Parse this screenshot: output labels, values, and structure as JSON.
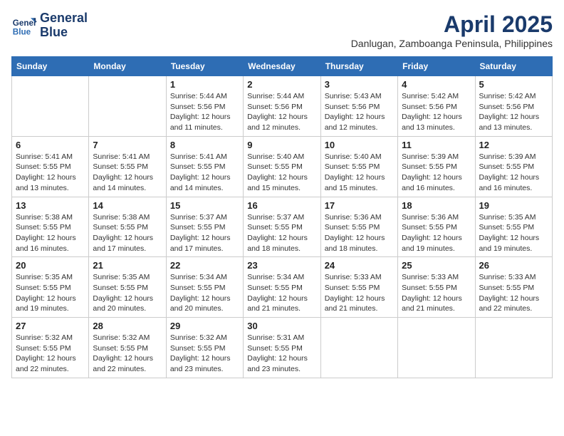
{
  "logo": {
    "line1": "General",
    "line2": "Blue"
  },
  "title": "April 2025",
  "subtitle": "Danlugan, Zamboanga Peninsula, Philippines",
  "days_of_week": [
    "Sunday",
    "Monday",
    "Tuesday",
    "Wednesday",
    "Thursday",
    "Friday",
    "Saturday"
  ],
  "weeks": [
    [
      {
        "num": "",
        "info": ""
      },
      {
        "num": "",
        "info": ""
      },
      {
        "num": "1",
        "info": "Sunrise: 5:44 AM\nSunset: 5:56 PM\nDaylight: 12 hours and 11 minutes."
      },
      {
        "num": "2",
        "info": "Sunrise: 5:44 AM\nSunset: 5:56 PM\nDaylight: 12 hours and 12 minutes."
      },
      {
        "num": "3",
        "info": "Sunrise: 5:43 AM\nSunset: 5:56 PM\nDaylight: 12 hours and 12 minutes."
      },
      {
        "num": "4",
        "info": "Sunrise: 5:42 AM\nSunset: 5:56 PM\nDaylight: 12 hours and 13 minutes."
      },
      {
        "num": "5",
        "info": "Sunrise: 5:42 AM\nSunset: 5:56 PM\nDaylight: 12 hours and 13 minutes."
      }
    ],
    [
      {
        "num": "6",
        "info": "Sunrise: 5:41 AM\nSunset: 5:55 PM\nDaylight: 12 hours and 13 minutes."
      },
      {
        "num": "7",
        "info": "Sunrise: 5:41 AM\nSunset: 5:55 PM\nDaylight: 12 hours and 14 minutes."
      },
      {
        "num": "8",
        "info": "Sunrise: 5:41 AM\nSunset: 5:55 PM\nDaylight: 12 hours and 14 minutes."
      },
      {
        "num": "9",
        "info": "Sunrise: 5:40 AM\nSunset: 5:55 PM\nDaylight: 12 hours and 15 minutes."
      },
      {
        "num": "10",
        "info": "Sunrise: 5:40 AM\nSunset: 5:55 PM\nDaylight: 12 hours and 15 minutes."
      },
      {
        "num": "11",
        "info": "Sunrise: 5:39 AM\nSunset: 5:55 PM\nDaylight: 12 hours and 16 minutes."
      },
      {
        "num": "12",
        "info": "Sunrise: 5:39 AM\nSunset: 5:55 PM\nDaylight: 12 hours and 16 minutes."
      }
    ],
    [
      {
        "num": "13",
        "info": "Sunrise: 5:38 AM\nSunset: 5:55 PM\nDaylight: 12 hours and 16 minutes."
      },
      {
        "num": "14",
        "info": "Sunrise: 5:38 AM\nSunset: 5:55 PM\nDaylight: 12 hours and 17 minutes."
      },
      {
        "num": "15",
        "info": "Sunrise: 5:37 AM\nSunset: 5:55 PM\nDaylight: 12 hours and 17 minutes."
      },
      {
        "num": "16",
        "info": "Sunrise: 5:37 AM\nSunset: 5:55 PM\nDaylight: 12 hours and 18 minutes."
      },
      {
        "num": "17",
        "info": "Sunrise: 5:36 AM\nSunset: 5:55 PM\nDaylight: 12 hours and 18 minutes."
      },
      {
        "num": "18",
        "info": "Sunrise: 5:36 AM\nSunset: 5:55 PM\nDaylight: 12 hours and 19 minutes."
      },
      {
        "num": "19",
        "info": "Sunrise: 5:35 AM\nSunset: 5:55 PM\nDaylight: 12 hours and 19 minutes."
      }
    ],
    [
      {
        "num": "20",
        "info": "Sunrise: 5:35 AM\nSunset: 5:55 PM\nDaylight: 12 hours and 19 minutes."
      },
      {
        "num": "21",
        "info": "Sunrise: 5:35 AM\nSunset: 5:55 PM\nDaylight: 12 hours and 20 minutes."
      },
      {
        "num": "22",
        "info": "Sunrise: 5:34 AM\nSunset: 5:55 PM\nDaylight: 12 hours and 20 minutes."
      },
      {
        "num": "23",
        "info": "Sunrise: 5:34 AM\nSunset: 5:55 PM\nDaylight: 12 hours and 21 minutes."
      },
      {
        "num": "24",
        "info": "Sunrise: 5:33 AM\nSunset: 5:55 PM\nDaylight: 12 hours and 21 minutes."
      },
      {
        "num": "25",
        "info": "Sunrise: 5:33 AM\nSunset: 5:55 PM\nDaylight: 12 hours and 21 minutes."
      },
      {
        "num": "26",
        "info": "Sunrise: 5:33 AM\nSunset: 5:55 PM\nDaylight: 12 hours and 22 minutes."
      }
    ],
    [
      {
        "num": "27",
        "info": "Sunrise: 5:32 AM\nSunset: 5:55 PM\nDaylight: 12 hours and 22 minutes."
      },
      {
        "num": "28",
        "info": "Sunrise: 5:32 AM\nSunset: 5:55 PM\nDaylight: 12 hours and 22 minutes."
      },
      {
        "num": "29",
        "info": "Sunrise: 5:32 AM\nSunset: 5:55 PM\nDaylight: 12 hours and 23 minutes."
      },
      {
        "num": "30",
        "info": "Sunrise: 5:31 AM\nSunset: 5:55 PM\nDaylight: 12 hours and 23 minutes."
      },
      {
        "num": "",
        "info": ""
      },
      {
        "num": "",
        "info": ""
      },
      {
        "num": "",
        "info": ""
      }
    ]
  ]
}
